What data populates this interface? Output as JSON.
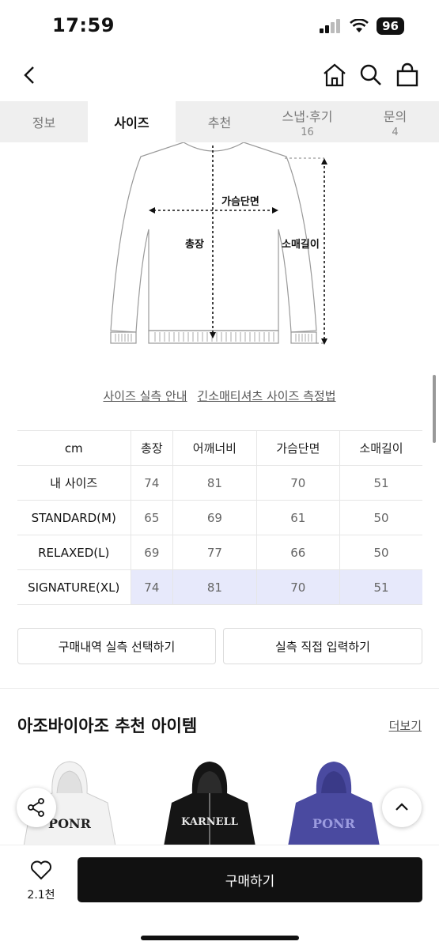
{
  "status": {
    "time": "17:59",
    "battery": "96"
  },
  "tabs": [
    {
      "label": "정보",
      "count": ""
    },
    {
      "label": "사이즈",
      "count": ""
    },
    {
      "label": "추천",
      "count": ""
    },
    {
      "label": "스냅·후기",
      "count": "16"
    },
    {
      "label": "문의",
      "count": "4"
    }
  ],
  "diagram": {
    "chest_label": "가슴단면",
    "length_label": "총장",
    "sleeve_label": "소매길이"
  },
  "guide_links": {
    "measure_guide": "사이즈 실측 안내",
    "method": "긴소매티셔츠 사이즈 측정법"
  },
  "size_table": {
    "headers": [
      "cm",
      "총장",
      "어깨너비",
      "가슴단면",
      "소매길이"
    ],
    "rows": [
      {
        "label": "내 사이즈",
        "values": [
          "74",
          "81",
          "70",
          "51"
        ]
      },
      {
        "label": "STANDARD(M)",
        "values": [
          "65",
          "69",
          "61",
          "50"
        ]
      },
      {
        "label": "RELAXED(L)",
        "values": [
          "69",
          "77",
          "66",
          "50"
        ]
      },
      {
        "label": "SIGNATURE(XL)",
        "values": [
          "74",
          "81",
          "70",
          "51"
        ]
      }
    ]
  },
  "actions": {
    "select_history": "구매내역 실측 선택하기",
    "direct_input": "실측 직접 입력하기"
  },
  "recommend": {
    "title": "아조바이아조 추천 아이템",
    "more": "더보기",
    "products": [
      {
        "color": "#f2f2f2",
        "print": "PONR",
        "print_color": "#222"
      },
      {
        "color": "#151515",
        "print": "KARNELL",
        "print_color": "#e8e8e8"
      },
      {
        "color": "#4a4aa0",
        "print": "PONR",
        "print_color": "#9c9ce0"
      }
    ]
  },
  "bottom": {
    "like_count": "2.1천",
    "buy_label": "구매하기"
  }
}
